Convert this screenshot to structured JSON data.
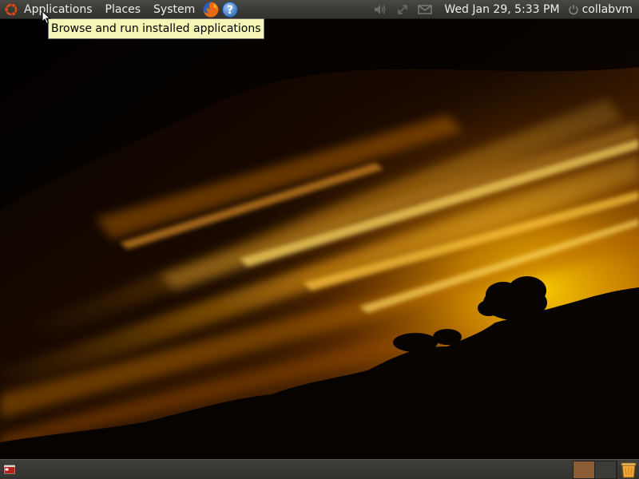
{
  "top_panel": {
    "menus": {
      "applications": "Applications",
      "places": "Places",
      "system": "System"
    },
    "launchers": [
      {
        "icon": "firefox-icon"
      },
      {
        "icon": "help-icon"
      }
    ],
    "tray": [
      {
        "icon": "volume-icon"
      },
      {
        "icon": "network-icon"
      },
      {
        "icon": "mail-icon"
      }
    ],
    "clock": "Wed Jan 29,  5:33 PM",
    "user": "collabvm"
  },
  "tooltip": {
    "text": "Browse and run installed applications"
  },
  "bottom_panel": {
    "workspaces": [
      {
        "state": "active"
      },
      {
        "state": "inactive"
      }
    ],
    "trash_icon": "trash-icon",
    "show_desktop_icon": "show-desktop-icon"
  },
  "colors": {
    "panel": "#3a3834",
    "tooltip_bg": "#f5f5b5",
    "ubuntu_orange": "#dd4814",
    "workspace_active": "#8c5d35"
  }
}
